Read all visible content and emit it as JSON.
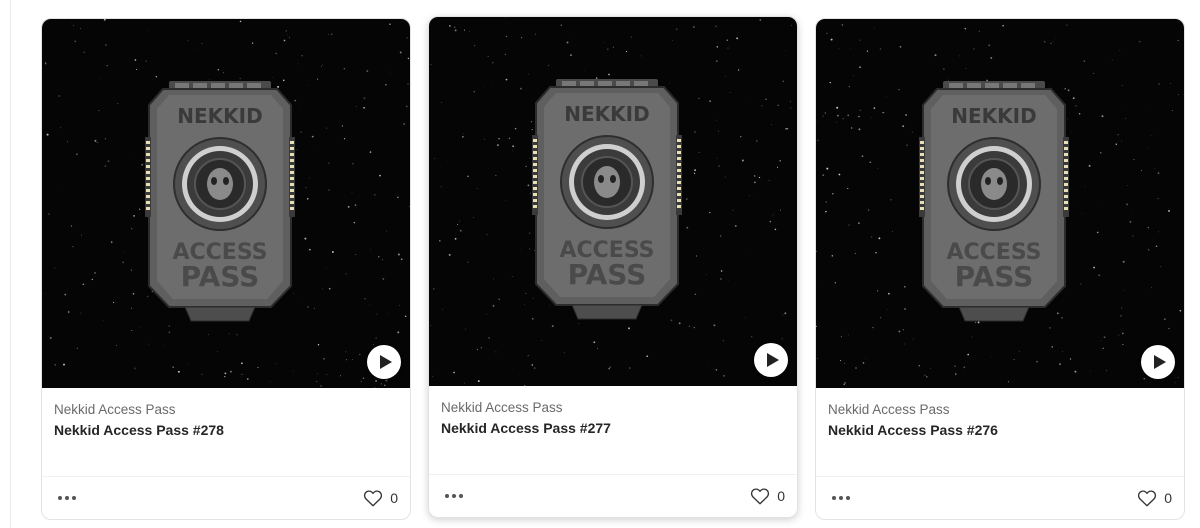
{
  "cards": [
    {
      "collection": "Nekkid Access Pass",
      "title": "Nekkid Access Pass #278",
      "likes": "0",
      "art": {
        "top_text": "NEKKID",
        "line1": "ACCESS",
        "line2": "PASS"
      }
    },
    {
      "collection": "Nekkid Access Pass",
      "title": "Nekkid Access Pass #277",
      "likes": "0",
      "art": {
        "top_text": "NEKKID",
        "line1": "ACCESS",
        "line2": "PASS"
      }
    },
    {
      "collection": "Nekkid Access Pass",
      "title": "Nekkid Access Pass #276",
      "likes": "0",
      "art": {
        "top_text": "NEKKID",
        "line1": "ACCESS",
        "line2": "PASS"
      }
    }
  ],
  "icons": {
    "play": "play-icon",
    "more": "more-horizontal-icon",
    "like": "heart-outline-icon"
  },
  "colors": {
    "media_bg": "#050506",
    "badge_metal": "#5f5f60",
    "badge_lights": "#e8dfb5"
  }
}
